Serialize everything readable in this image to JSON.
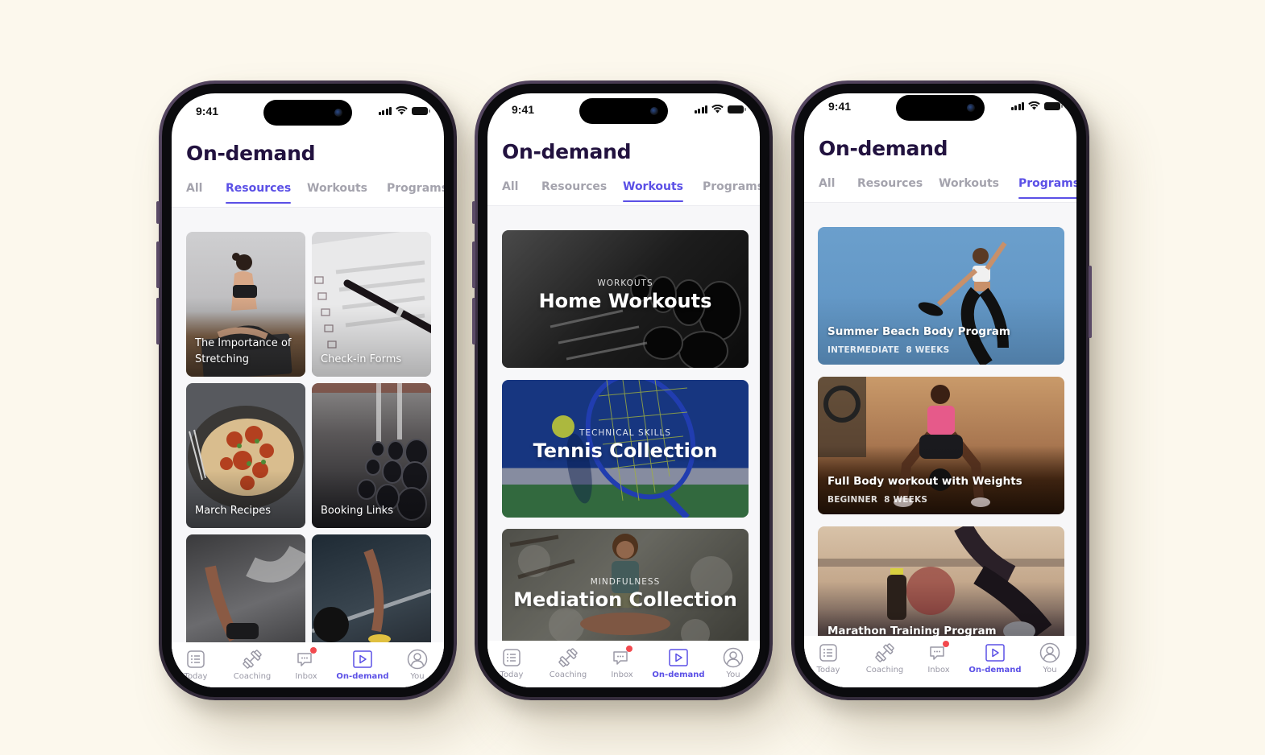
{
  "status_bar": {
    "time": "9:41"
  },
  "page_title": "On-demand",
  "tabs": [
    "All",
    "Resources",
    "Workouts",
    "Programs"
  ],
  "bottom_nav": [
    {
      "label": "Today",
      "icon": "list-icon"
    },
    {
      "label": "Coaching",
      "icon": "dumbbell-icon"
    },
    {
      "label": "Inbox",
      "icon": "chat-icon",
      "badge": true
    },
    {
      "label": "On-demand",
      "icon": "play-icon"
    },
    {
      "label": "You",
      "icon": "user-icon"
    }
  ],
  "colors": {
    "accent": "#5b50e6",
    "title": "#22123f",
    "inactive": "#a4a3ad",
    "badge": "#f2494e",
    "background": "#fcf8ed"
  },
  "phones": [
    {
      "active_tab": "Resources",
      "resources": [
        {
          "label": "The Importance of Stretching"
        },
        {
          "label": "Check-in Forms"
        },
        {
          "label": "March Recipes"
        },
        {
          "label": "Booking Links"
        },
        {
          "label": ""
        },
        {
          "label": ""
        }
      ]
    },
    {
      "active_tab": "Workouts",
      "collections": [
        {
          "eyebrow": "WORKOUTS",
          "title": "Home Workouts"
        },
        {
          "eyebrow": "TECHNICAL SKILLS",
          "title": "Tennis Collection"
        },
        {
          "eyebrow": "MINDFULNESS",
          "title": "Mediation Collection"
        }
      ]
    },
    {
      "active_tab": "Programs",
      "programs": [
        {
          "title": "Summer Beach Body Program",
          "level": "INTERMEDIATE",
          "duration": "8 WEEKS"
        },
        {
          "title": "Full Body workout with Weights",
          "level": "BEGINNER",
          "duration": "8 WEEKS"
        },
        {
          "title": "Marathon Training Program",
          "level": "",
          "duration": ""
        }
      ]
    }
  ]
}
